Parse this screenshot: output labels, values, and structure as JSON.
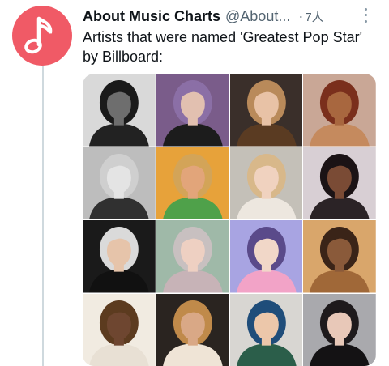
{
  "tweet": {
    "display_name": "About Music Charts",
    "handle": "@About...",
    "separator": "·",
    "time": "7人",
    "text": "Artists that were named 'Greatest Pop Star' by Billboard:"
  },
  "avatar": {
    "icon": "music-note-icon",
    "color": "#f05a66"
  },
  "colors": {
    "text": "#0f1419",
    "secondary": "#536471",
    "thread_line": "#cfd9de"
  },
  "photos": [
    {
      "bg": "#d9d9d9",
      "skin": "#6e6e6e",
      "hair": "#1a1a1a",
      "cloth": "#222222"
    },
    {
      "bg": "#7a5c8a",
      "skin": "#e2c0b0",
      "hair": "#8b6fa6",
      "cloth": "#1c1c1c"
    },
    {
      "bg": "#3a2f2a",
      "skin": "#e8c2a6",
      "hair": "#b98a5a",
      "cloth": "#5a3b22"
    },
    {
      "bg": "#c9a796",
      "skin": "#a8673f",
      "hair": "#7a2f1c",
      "cloth": "#c58a5e"
    },
    {
      "bg": "#bdbdbd",
      "skin": "#e4e4e4",
      "hair": "#cfcfcf",
      "cloth": "#303030"
    },
    {
      "bg": "#e7a23a",
      "skin": "#e2a57a",
      "hair": "#d3a458",
      "cloth": "#4fa14a"
    },
    {
      "bg": "#c4c0b8",
      "skin": "#f0d2bf",
      "hair": "#d8b88a",
      "cloth": "#ede7df"
    },
    {
      "bg": "#d8cfd4",
      "skin": "#7a4b35",
      "hair": "#1b1315",
      "cloth": "#2b2326"
    },
    {
      "bg": "#1a1a1a",
      "skin": "#e6c4aa",
      "hair": "#dadada",
      "cloth": "#111111"
    },
    {
      "bg": "#9fb9a8",
      "skin": "#eed0c2",
      "hair": "#c8c0c0",
      "cloth": "#c7b3b7"
    },
    {
      "bg": "#a8a4e2",
      "skin": "#f1d7c8",
      "hair": "#5a4a8a",
      "cloth": "#f2a3c7"
    },
    {
      "bg": "#d9a66b",
      "skin": "#8a5a3a",
      "hair": "#3a2418",
      "cloth": "#a06838"
    },
    {
      "bg": "#f1ebe1",
      "skin": "#6e4630",
      "hair": "#5c3b1f",
      "cloth": "#e8e0d4"
    },
    {
      "bg": "#2a2420",
      "skin": "#d9a886",
      "hair": "#c08a4a",
      "cloth": "#efe4d6"
    },
    {
      "bg": "#d8d6d2",
      "skin": "#ecc7aa",
      "hair": "#1f4d7a",
      "cloth": "#2b5e4a"
    },
    {
      "bg": "#a9a9ad",
      "skin": "#e8c8b8",
      "hair": "#1e1a1c",
      "cloth": "#141214"
    }
  ]
}
